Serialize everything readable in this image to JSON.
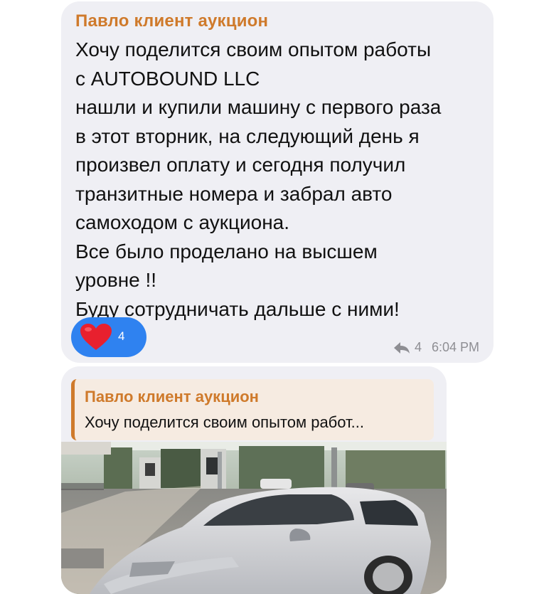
{
  "message1": {
    "sender": "Павло клиент аукцион",
    "lines": [
      "Хочу поделится своим опытом работы",
      "с AUTOBOUND LLC",
      "нашли и купили машину с первого раза",
      "в этот вторник, на следующий день я",
      "произвел оплату и сегодня получил",
      "транзитные номера и забрал авто",
      "самоходом с аукциона.",
      "Все было проделано на высшем",
      "уровне !!",
      "Буду сотрудничать дальше с ними!"
    ],
    "reaction": {
      "icon": "heart-icon",
      "count": "4",
      "color": "#2f82f0"
    },
    "forwards": "4",
    "time": "6:04 PM"
  },
  "message2": {
    "reply": {
      "sender": "Павло клиент аукцион",
      "text": "Хочу поделится своим опытом работ..."
    },
    "photo": {
      "subject": "silver sedan at gas station"
    }
  },
  "colors": {
    "bubble": "#efeff4",
    "sender": "#cf7a2b",
    "reaction_bg": "#2f82f0",
    "meta": "#8e8e93"
  }
}
